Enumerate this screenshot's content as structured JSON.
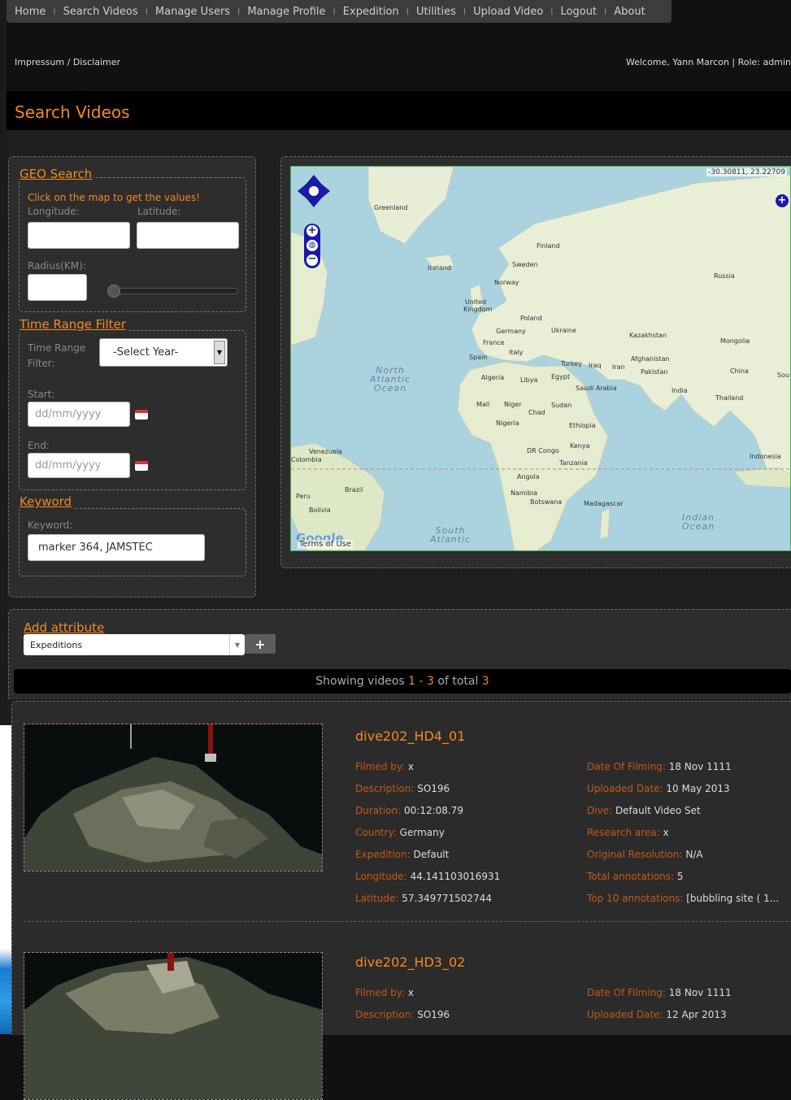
{
  "nav": {
    "items": [
      "Home",
      "Search Videos",
      "Manage Users",
      "Manage Profile",
      "Expedition",
      "Utilities",
      "Upload Video",
      "Logout",
      "About"
    ],
    "separator": "I"
  },
  "header": {
    "impressum": "Impressum / Disclaimer",
    "welcome": "Welcome, Yann Marcon | Role: admin"
  },
  "page": {
    "title": "Search Videos"
  },
  "geo": {
    "legend": "GEO Search",
    "hint": "Click on the map to get the values!",
    "longitude_label": "Longitude:",
    "latitude_label": "Latitude:",
    "radius_label": "Radius(KM):",
    "radius_level": 0
  },
  "time": {
    "legend": "Time Range Filter",
    "filter_label_1": "Time Range",
    "filter_label_2": "Filter:",
    "select_value": "-Select Year-",
    "start_label": "Start:",
    "start_placeholder": "dd/mm/yyyy",
    "end_label": "End:",
    "end_placeholder": "dd/mm/yyyy"
  },
  "keyword": {
    "legend": "Keyword",
    "label": "Keyword:",
    "value": "marker 364, JAMSTEC"
  },
  "map": {
    "coordinates": "-30.30811, 23.22709",
    "labels": [
      "Greenland",
      "Iceland",
      "Finland",
      "Sweden",
      "Norway",
      "United Kingdom",
      "Poland",
      "Germany",
      "Ukraine",
      "France",
      "Italy",
      "Spain",
      "Turkey",
      "Russia",
      "Kazakhstan",
      "Mongolia",
      "China",
      "Afghanistan",
      "Iraq",
      "Iran",
      "Pakistan",
      "Saudi Arabia",
      "Egypt",
      "Libya",
      "Algeria",
      "Mali",
      "Niger",
      "Chad",
      "Sudan",
      "Nigeria",
      "Ethiopia",
      "Kenya",
      "DR Congo",
      "Tanzania",
      "Angola",
      "Namibia",
      "Botswana",
      "Madagascar",
      "India",
      "Thailand",
      "Indonesia",
      "Venezuela",
      "Colombia",
      "Peru",
      "Brazil",
      "Bolivia",
      "Sou"
    ],
    "oceans": [
      "North Atlantic Ocean",
      "South Atlantic",
      "Indian Ocean"
    ],
    "terms": "Terms of Use",
    "google": "Google"
  },
  "attribute": {
    "title": "Add attribute",
    "select_value": "Expeditions",
    "add_label": "+"
  },
  "showing": {
    "prefix": "Showing videos ",
    "from": "1",
    "dash": " - ",
    "to": "3",
    "middle": " of total ",
    "total": "3"
  },
  "videos": [
    {
      "title": "dive202_HD4_01",
      "left": [
        {
          "k": "Filmed by:",
          "v": "x"
        },
        {
          "k": "Description:",
          "v": "SO196"
        },
        {
          "k": "Duration:",
          "v": "00:12:08.79"
        },
        {
          "k": "Country:",
          "v": "Germany"
        },
        {
          "k": "Expedition:",
          "v": "Default"
        },
        {
          "k": "Longitude:",
          "v": "44.141103016931"
        },
        {
          "k": "Latitude:",
          "v": "57.349771502744"
        }
      ],
      "right": [
        {
          "k": "Date Of Filming:",
          "v": "18 Nov 1111"
        },
        {
          "k": "Uploaded Date:",
          "v": "10 May 2013"
        },
        {
          "k": "Dive:",
          "v": "Default Video Set"
        },
        {
          "k": "Research area:",
          "v": "x"
        },
        {
          "k": "Original Resolution:",
          "v": "N/A"
        },
        {
          "k": "Total annotations:",
          "v": "5"
        },
        {
          "k": "Top 10 annotations:",
          "v": "[bubbling site ( 1..."
        }
      ]
    },
    {
      "title": "dive202_HD3_02",
      "left": [
        {
          "k": "Filmed by:",
          "v": "x"
        },
        {
          "k": "Description:",
          "v": "SO196"
        }
      ],
      "right": [
        {
          "k": "Date Of Filming:",
          "v": "18 Nov 1111"
        },
        {
          "k": "Uploaded Date:",
          "v": "12 Apr 2013"
        }
      ]
    }
  ]
}
